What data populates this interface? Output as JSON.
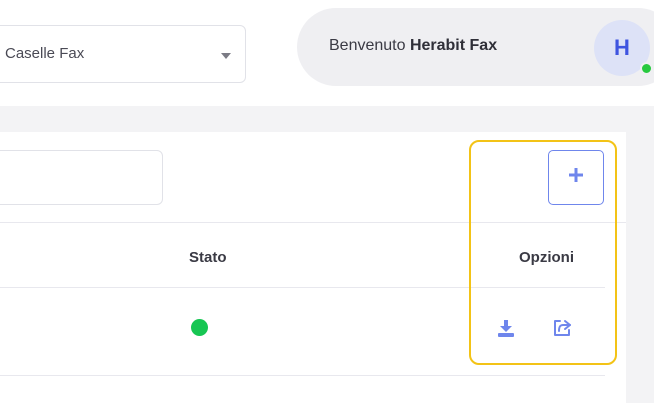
{
  "header": {
    "select": {
      "value": "Caselle Fax"
    },
    "welcome": {
      "prefix": "Benvenuto ",
      "name": "Herabit Fax"
    },
    "avatar": {
      "initial": "H",
      "online": true
    }
  },
  "search": {
    "placeholder": ""
  },
  "table": {
    "columns": {
      "status": "Stato",
      "options": "Opzioni"
    },
    "rows": [
      {
        "status": "active",
        "status_color": "#17c653",
        "actions": [
          "download-icon",
          "share-icon"
        ]
      }
    ]
  },
  "colors": {
    "accent": "#6f86ec",
    "highlight": "#f3c316",
    "online": "#27c93f"
  }
}
